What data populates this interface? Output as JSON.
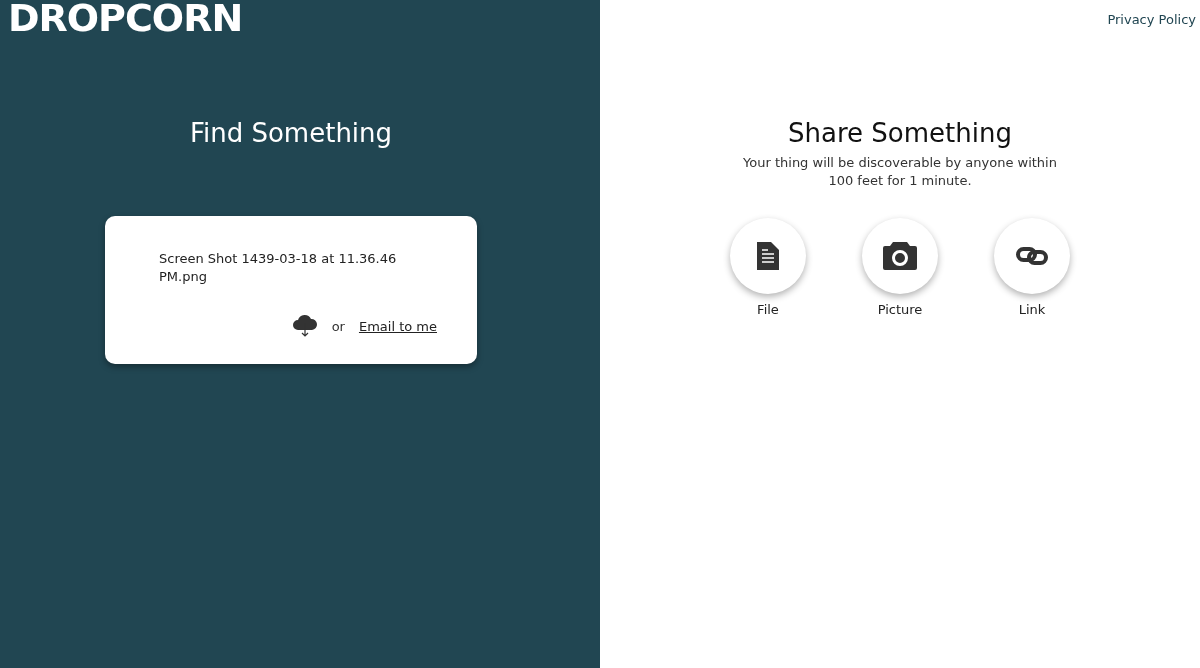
{
  "logo": "DROPCORN",
  "privacy_link": "Privacy Policy",
  "find": {
    "title": "Find Something",
    "item": {
      "filename": "Screen Shot 1439-03-18 at 11.36.46 PM.png",
      "separator": "or",
      "email_link": "Email to me"
    }
  },
  "share": {
    "title": "Share Something",
    "description": "Your thing will be discoverable by anyone within 100 feet for 1 minute.",
    "options": [
      {
        "kind": "file",
        "label": "File"
      },
      {
        "kind": "picture",
        "label": "Picture"
      },
      {
        "kind": "link",
        "label": "Link"
      }
    ]
  }
}
